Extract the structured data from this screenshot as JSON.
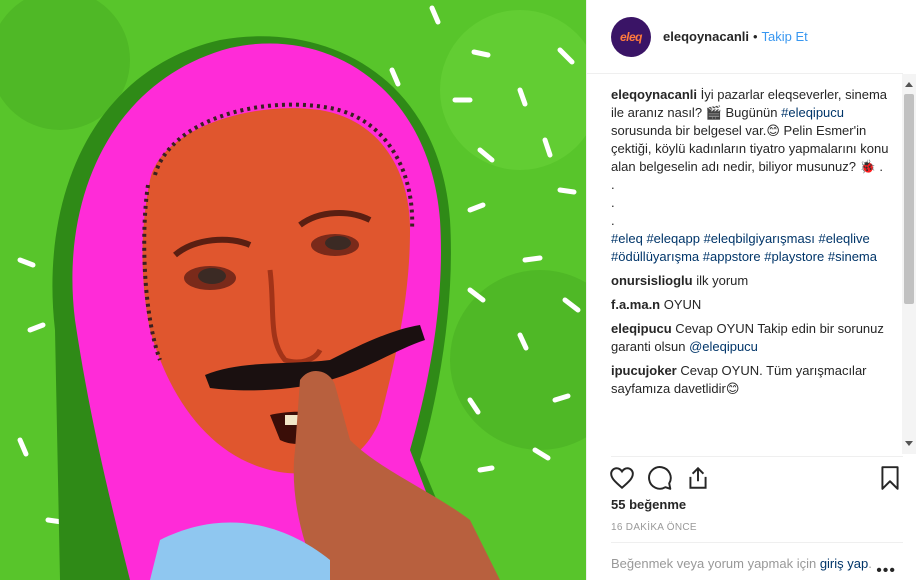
{
  "header": {
    "avatar_text": "eleq",
    "username": "eleqoynacanli",
    "separator": "•",
    "follow_label": "Takip Et"
  },
  "caption": {
    "username": "eleqoynacanli",
    "text_1": " İyi pazarlar eleqseverler, sinema ile aranız nasıl? 🎬 Bugünün ",
    "hashtag_1": "#eleqipucu",
    "text_2": " sorusunda bir belgesel var.😊 Pelin Esmer'in çektiği, köylü kadınların tiyatro yapmalarını konu alan belgeselin adı nedir, biliyor musunuz? 🐞 .",
    "dots": [
      ".",
      ".",
      "."
    ],
    "hashtags": [
      "#eleq",
      "#eleqapp",
      "#eleqbilgiyarışması",
      "#eleqlive",
      "#ödüllüyarışma",
      "#appstore",
      "#playstore",
      "#sinema"
    ]
  },
  "comments": [
    {
      "username": "onursislioglu",
      "text": " ilk yorum"
    },
    {
      "username": "f.a.ma.n",
      "text": " OYUN"
    },
    {
      "username": "eleqipucu",
      "text": " Cevap OYUN Takip edin bir sorunuz garanti olsun ",
      "mention": "@eleqipucu"
    },
    {
      "username": "ipucujoker",
      "text": " Cevap OYUN. Tüm yarışmacılar sayfamıza davetlidir😊"
    }
  ],
  "actions": {
    "like_icon": "heart-icon",
    "comment_icon": "comment-icon",
    "share_icon": "share-icon",
    "save_icon": "bookmark-icon"
  },
  "likes_text": "55 beğenme",
  "time_text": "16 DAKİKA ÖNCE",
  "login": {
    "prompt": "Beğenmek veya yorum yapmak için ",
    "link": "giriş yap",
    "suffix": "."
  },
  "more_menu": "•••",
  "colors": {
    "background_green": "#56c42a",
    "hood_pink": "#ff2bd8",
    "link_blue": "#3897f0",
    "hashtag_blue": "#003569"
  }
}
